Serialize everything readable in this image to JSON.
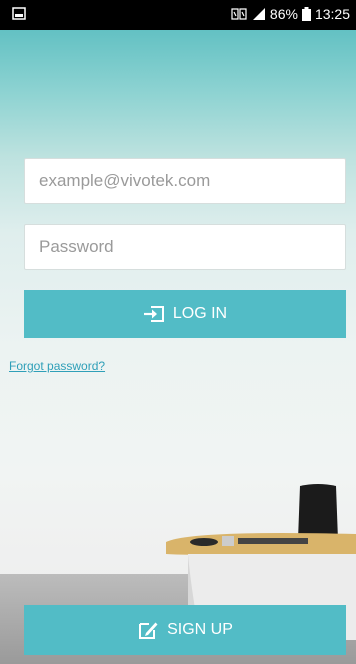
{
  "status_bar": {
    "battery": "86%",
    "time": "13:25"
  },
  "login_form": {
    "email_placeholder": "example@vivotek.com",
    "password_placeholder": "Password",
    "login_label": "LOG IN",
    "forgot_label": "Forgot password?"
  },
  "footer": {
    "signup_label": "SIGN UP"
  },
  "colors": {
    "accent": "#52bcc6",
    "link": "#2f9fb8"
  },
  "icons": {
    "login": "login-arrow-icon",
    "signup": "edit-pencil-icon",
    "status_left": "notification-icon"
  }
}
